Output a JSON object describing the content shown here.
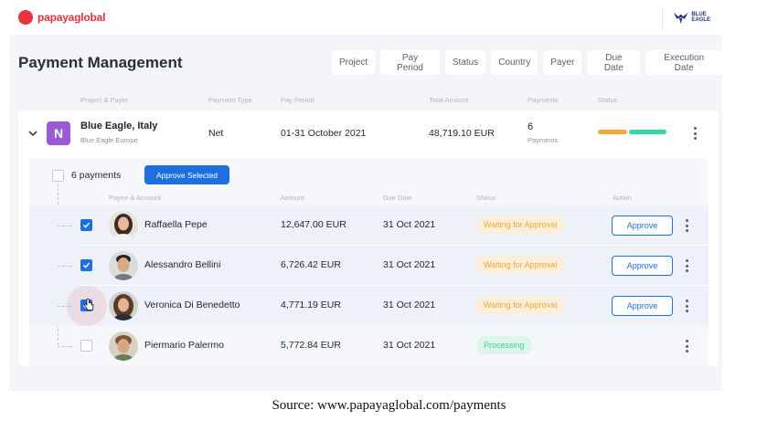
{
  "brand": {
    "name": "papayaglobal",
    "color": "#e8323c"
  },
  "client_logo": {
    "text": "BLUE EAGLE",
    "icon": "eagle-icon"
  },
  "page": {
    "title": "Payment Management"
  },
  "filters": [
    "Project",
    "Pay Period",
    "Status",
    "Country",
    "Payer",
    "Due Date",
    "Execution Date"
  ],
  "columns": {
    "project_payer": "Project & Payer",
    "payment_type": "Payment Type",
    "pay_period": "Pay Period",
    "total_amount": "Total Amount",
    "payments": "Payments",
    "status": "Status"
  },
  "project": {
    "avatar_letter": "N",
    "name": "Blue Eagle, Italy",
    "subtitle": "Blue Eagle Europe",
    "type": "Net",
    "period": "01-31 October 2021",
    "amount": "48,719.10 EUR",
    "count": "6",
    "count_label": "Payments",
    "status_colors": {
      "pending": "#f5a93b",
      "done": "#35d6a9"
    }
  },
  "batch": {
    "count_label": "6 payments",
    "approve_selected_label": "Approve Selected"
  },
  "sub_columns": {
    "payee": "Payee & Account",
    "amount": "Amount",
    "due_date": "Due Date",
    "status": "Status",
    "action": "Action"
  },
  "payments": [
    {
      "name": "Raffaella Pepe",
      "amount": "12,647.00 EUR",
      "due": "31 Oct 2021",
      "status": "Waiting for Approval",
      "action": "Approve",
      "checked": true
    },
    {
      "name": "Alessandro Bellini",
      "amount": "6,726.42 EUR",
      "due": "31 Oct 2021",
      "status": "Waiting for Approval",
      "action": "Approve",
      "checked": true
    },
    {
      "name": "Veronica Di Benedetto",
      "amount": "4,771.19 EUR",
      "due": "31 Oct 2021",
      "status": "Waiting for Approval",
      "action": "Approve",
      "checked": true
    },
    {
      "name": "Piermario Palermo",
      "amount": "5,772.84 EUR",
      "due": "31 Oct 2021",
      "status": "Processing",
      "action": "",
      "checked": false
    }
  ],
  "accent_color": "#1d6fe0",
  "source_caption": "Source: www.papayaglobal.com/payments"
}
